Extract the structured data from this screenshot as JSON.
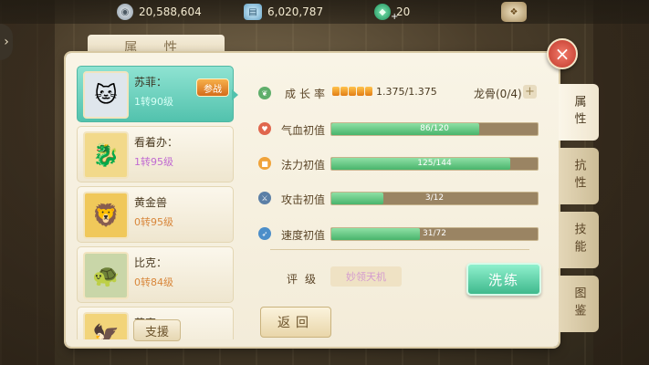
{
  "currencies": [
    {
      "icon": "silver-coin-icon",
      "value": "20,588,604"
    },
    {
      "icon": "silver-ingot-icon",
      "value": "6,020,787"
    },
    {
      "icon": "jade-coin-icon",
      "value": "20"
    }
  ],
  "panel": {
    "title": "属 性"
  },
  "pets": [
    {
      "name": "苏菲：",
      "level": "1转90级",
      "badge": "参战",
      "active": true
    },
    {
      "name": "看着办：",
      "level": "1转95级",
      "level_color": "purple"
    },
    {
      "name": "黄金兽",
      "level": "0转95级",
      "level_color": "orange"
    },
    {
      "name": "比克：",
      "level": "0转84级",
      "level_color": "orange"
    },
    {
      "name": "艾克：",
      "level": ""
    }
  ],
  "support_label": "支援",
  "growth": {
    "label": "成长率",
    "stars": 5,
    "value": "1.375/1.375"
  },
  "dragon_bone": {
    "label": "龙骨(0/4)"
  },
  "stats": [
    {
      "label": "气血初值",
      "text": "86/120",
      "fraction": 0.717,
      "icon": "heart-icon",
      "color": "#e0664d"
    },
    {
      "label": "法力初值",
      "text": "125/144",
      "fraction": 0.868,
      "icon": "mana-icon",
      "color": "#f0a33a"
    },
    {
      "label": "攻击初值",
      "text": "3/12",
      "fraction": 0.25,
      "icon": "sword-icon",
      "color": "#5b7fa6"
    },
    {
      "label": "速度初值",
      "text": "31/72",
      "fraction": 0.43,
      "icon": "speed-icon",
      "color": "#4c8ec9"
    }
  ],
  "grade": {
    "label": "评级",
    "value": "妙领天机"
  },
  "buttons": {
    "wash": "洗练",
    "back": "返回"
  },
  "side_tabs": [
    "属性",
    "抗性",
    "技能",
    "图鉴"
  ]
}
